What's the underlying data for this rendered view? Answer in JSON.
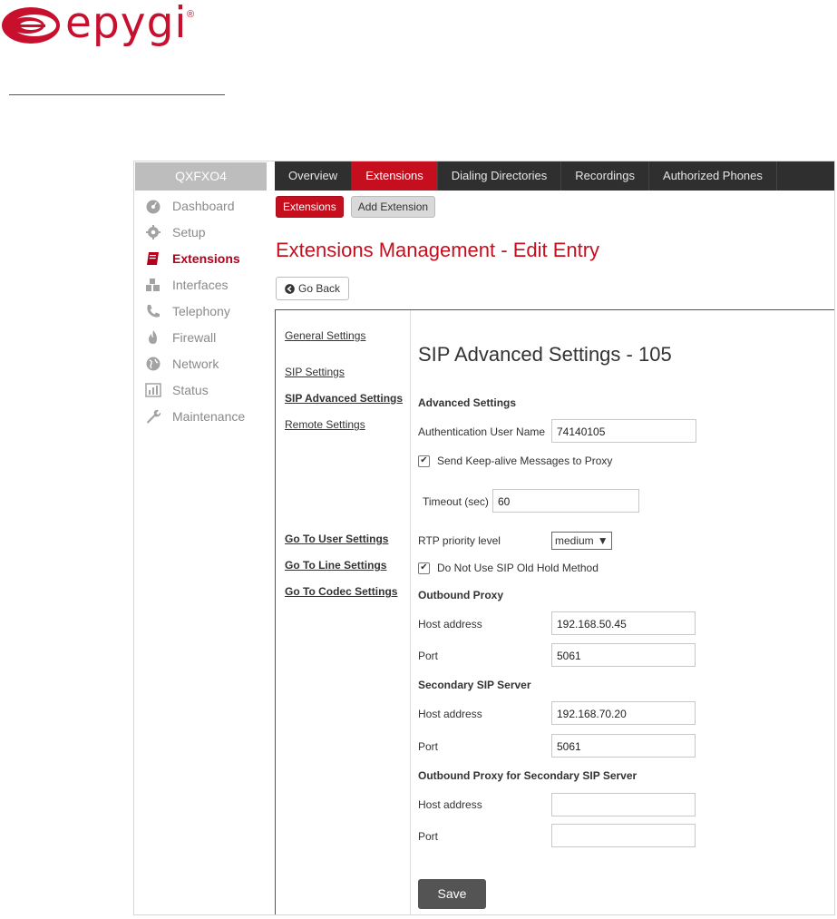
{
  "brand": {
    "name": "epygi",
    "registered": "®",
    "color": "#c8102e"
  },
  "sidebar": {
    "device": "QXFXO4",
    "items": [
      {
        "label": "Dashboard",
        "icon": "dashboard-icon"
      },
      {
        "label": "Setup",
        "icon": "gear-icon"
      },
      {
        "label": "Extensions",
        "icon": "book-icon",
        "active": true
      },
      {
        "label": "Interfaces",
        "icon": "network-nodes-icon"
      },
      {
        "label": "Telephony",
        "icon": "phone-icon"
      },
      {
        "label": "Firewall",
        "icon": "fire-icon"
      },
      {
        "label": "Network",
        "icon": "globe-icon"
      },
      {
        "label": "Status",
        "icon": "bar-chart-icon"
      },
      {
        "label": "Maintenance",
        "icon": "wrench-icon"
      }
    ]
  },
  "topnav": {
    "tabs": [
      {
        "label": "Overview"
      },
      {
        "label": "Extensions",
        "active": true
      },
      {
        "label": "Dialing Directories"
      },
      {
        "label": "Recordings"
      },
      {
        "label": "Authorized Phones"
      }
    ]
  },
  "subnav": {
    "extensions": "Extensions",
    "add_extension": "Add Extension"
  },
  "page": {
    "title": "Extensions Management - Edit Entry",
    "go_back": "Go Back"
  },
  "left_links": {
    "general": "General Settings",
    "sip": "SIP Settings",
    "sip_advanced": "SIP Advanced Settings",
    "remote": "Remote Settings",
    "user": "Go To User Settings",
    "line": "Go To Line Settings",
    "codec": "Go To Codec Settings"
  },
  "form": {
    "section_title": "SIP Advanced Settings - 105",
    "advanced_heading": "Advanced Settings",
    "auth_user_label": "Authentication User Name",
    "auth_user_value": "74140105",
    "keepalive_label": "Send Keep-alive Messages to Proxy",
    "keepalive_checked": true,
    "timeout_label": "Timeout (sec)",
    "timeout_value": "60",
    "rtp_label": "RTP priority level",
    "rtp_value": "medium",
    "old_hold_label": "Do Not Use SIP Old Hold Method",
    "old_hold_checked": true,
    "outbound_heading": "Outbound Proxy",
    "outbound_host_label": "Host address",
    "outbound_host_value": "192.168.50.45",
    "outbound_port_label": "Port",
    "outbound_port_value": "5061",
    "secondary_heading": "Secondary SIP Server",
    "secondary_host_label": "Host address",
    "secondary_host_value": "192.168.70.20",
    "secondary_port_label": "Port",
    "secondary_port_value": "5061",
    "outbound2_heading": "Outbound Proxy for Secondary SIP Server",
    "outbound2_host_label": "Host address",
    "outbound2_host_value": "",
    "outbound2_port_label": "Port",
    "outbound2_port_value": "",
    "save": "Save"
  },
  "colors": {
    "accent": "#c50f1f",
    "topnav_bg": "#2f2f2f",
    "save_bg": "#545454"
  }
}
